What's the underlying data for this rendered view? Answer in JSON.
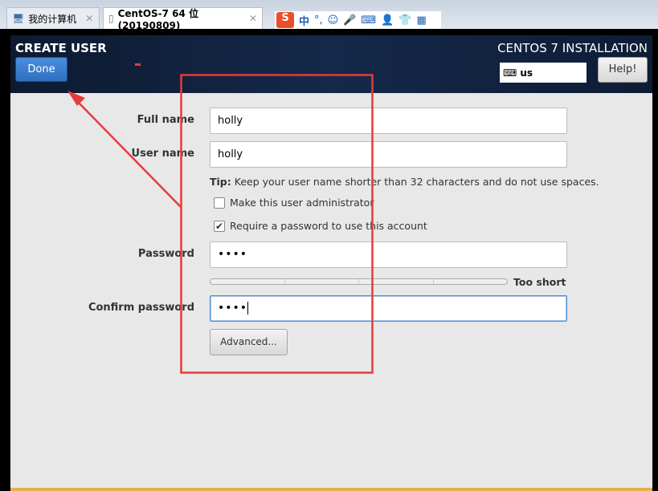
{
  "tabs": [
    {
      "label": "我的计算机",
      "icon": "monitor-icon"
    },
    {
      "label": "CentOS-7 64 位(20190809)",
      "icon": "vm-icon",
      "active": true
    }
  ],
  "ime": {
    "logo": "S",
    "mode": "中",
    "punct": "°,"
  },
  "header": {
    "title": "CREATE USER",
    "done_label": "Done",
    "installation": "CENTOS 7 INSTALLATION",
    "keyboard_layout": "us",
    "help_label": "Help!"
  },
  "form": {
    "full_name_label": "Full name",
    "full_name_value": "holly",
    "user_name_label": "User name",
    "user_name_value": "holly",
    "tip_bold": "Tip:",
    "tip_text": " Keep your user name shorter than 32 characters and do not use spaces.",
    "admin_label": "Make this user administrator",
    "admin_checked": false,
    "require_password_label": "Require a password to use this account",
    "require_password_checked": true,
    "password_label": "Password",
    "password_value": "••••",
    "strength_text": "Too short",
    "strength_level": 0,
    "confirm_label": "Confirm password",
    "confirm_value": "••••",
    "advanced_label": "Advanced..."
  },
  "colors": {
    "accent": "#2f6fc0",
    "annotation": "#e83a3a",
    "header_bg": "#0d1a30"
  }
}
